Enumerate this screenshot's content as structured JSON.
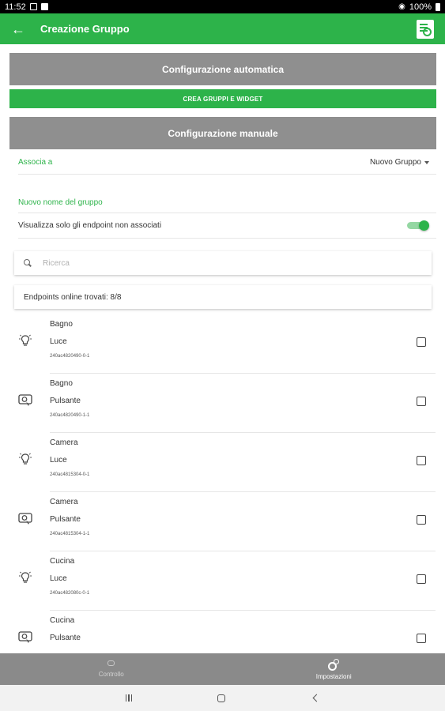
{
  "status_bar": {
    "time": "11:52",
    "battery": "100%"
  },
  "app_bar": {
    "title": "Creazione Gruppo"
  },
  "buttons": {
    "auto_config": "Configurazione automatica",
    "create_groups": "CREA GRUPPI E WIDGET",
    "manual_config": "Configurazione manuale"
  },
  "form": {
    "associate_label": "Associa a",
    "associate_value": "Nuovo Gruppo",
    "group_name_placeholder": "Nuovo nome del gruppo",
    "only_unassociated_label": "Visualizza solo gli endpoint non associati",
    "only_unassociated_on": true
  },
  "search": {
    "placeholder": "Ricerca"
  },
  "endpoints_found": "Endpoints online trovati: 8/8",
  "endpoints": [
    {
      "room": "Bagno",
      "type": "Luce",
      "id": "240ac4820490-0-1",
      "icon": "lightbulb-icon",
      "checked": false
    },
    {
      "room": "Bagno",
      "type": "Pulsante",
      "id": "240ac4820490-1-1",
      "icon": "push-button-icon",
      "checked": false
    },
    {
      "room": "Camera",
      "type": "Luce",
      "id": "240ac4815304-0-1",
      "icon": "lightbulb-icon",
      "checked": false
    },
    {
      "room": "Camera",
      "type": "Pulsante",
      "id": "240ac4815304-1-1",
      "icon": "push-button-icon",
      "checked": false
    },
    {
      "room": "Cucina",
      "type": "Luce",
      "id": "240ac482080c-0-1",
      "icon": "lightbulb-icon",
      "checked": false
    },
    {
      "room": "Cucina",
      "type": "Pulsante",
      "id": "",
      "icon": "push-button-icon",
      "checked": false
    }
  ],
  "bottom_nav": [
    {
      "label": "Controllo",
      "icon": "control-icon",
      "active": false
    },
    {
      "label": "Impostazioni",
      "icon": "gears-icon",
      "active": true
    }
  ],
  "colors": {
    "accent": "#2db34a",
    "grey_button": "#8f8f8f",
    "bottom_nav": "#8a8a8a"
  }
}
